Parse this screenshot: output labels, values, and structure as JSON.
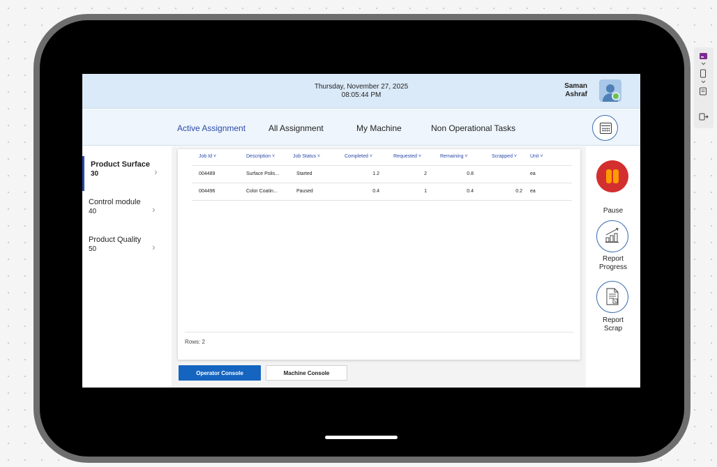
{
  "header": {
    "date": "Thursday, November 27, 2025",
    "time": "08:05:44 PM",
    "user_first": "Saman",
    "user_last": "Ashraf"
  },
  "nav": {
    "tabs": [
      {
        "label": "Active Assignment",
        "active": true
      },
      {
        "label": "All Assignment",
        "active": false
      },
      {
        "label": "My Machine",
        "active": false
      },
      {
        "label": "Non Operational Tasks",
        "active": false
      }
    ],
    "calendar_icon": "calendar-icon"
  },
  "sidebar": {
    "items": [
      {
        "label": "Product Surface",
        "count": "30",
        "active": true
      },
      {
        "label": "Control module",
        "count": "40",
        "active": false
      },
      {
        "label": "Product Quality",
        "count": "50",
        "active": false
      }
    ]
  },
  "grid": {
    "columns": [
      "Job Id",
      "Description",
      "Job Status",
      "Completed",
      "Requested",
      "Remaining",
      "Scrapped",
      "Unit"
    ],
    "rows": [
      {
        "job_id": "004489",
        "description": "Surface Polis...",
        "status": "Started",
        "completed": "1.2",
        "requested": "2",
        "remaining": "0.8",
        "scrapped": "",
        "unit": "ea"
      },
      {
        "job_id": "004496",
        "description": "Color Coatin...",
        "status": "Paused",
        "completed": "0.4",
        "requested": "1",
        "remaining": "0.4",
        "scrapped": "0.2",
        "unit": "ea"
      }
    ],
    "rows_label": "Rows: 2"
  },
  "buttons": {
    "operator_console": "Operator Console",
    "machine_console": "Machine Console"
  },
  "actions": {
    "pause_label": "Pause",
    "report_progress_line1": "Report",
    "report_progress_line2": "Progress",
    "report_scrap_line1": "Report",
    "report_scrap_line2": "Scrap"
  },
  "colors": {
    "header_bg": "#dbeaf8",
    "accent_blue": "#2b4aa8",
    "primary_button": "#1565c0",
    "pause_red": "#d32f2f",
    "pause_orange": "#ff9a00"
  },
  "canvas_tools": {
    "icons": [
      "app-tile-icon",
      "phone-icon",
      "tablet-list-icon",
      "export-icon"
    ]
  }
}
